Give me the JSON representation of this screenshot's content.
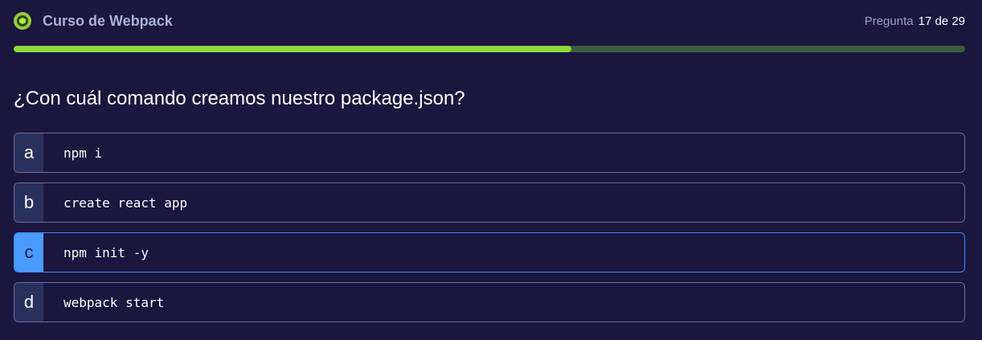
{
  "header": {
    "course_title": "Curso de Webpack",
    "progress_label": "Pregunta",
    "progress_value": "17 de 29"
  },
  "progress": {
    "current": 17,
    "total": 29,
    "fraction": 0.586
  },
  "question": {
    "text": "¿Con cuál comando creamos nuestro package.json?"
  },
  "options": [
    {
      "letter": "a",
      "text": "npm i",
      "selected": false
    },
    {
      "letter": "b",
      "text": "create react app",
      "selected": false
    },
    {
      "letter": "c",
      "text": "npm init -y",
      "selected": true
    },
    {
      "letter": "d",
      "text": "webpack start",
      "selected": false
    }
  ],
  "colors": {
    "background": "#1a163e",
    "progress_fill": "#8ed93a",
    "progress_track": "#3b5d3e",
    "selected_accent": "#4a9bff"
  },
  "icons": {
    "course": "webpack-icon"
  }
}
